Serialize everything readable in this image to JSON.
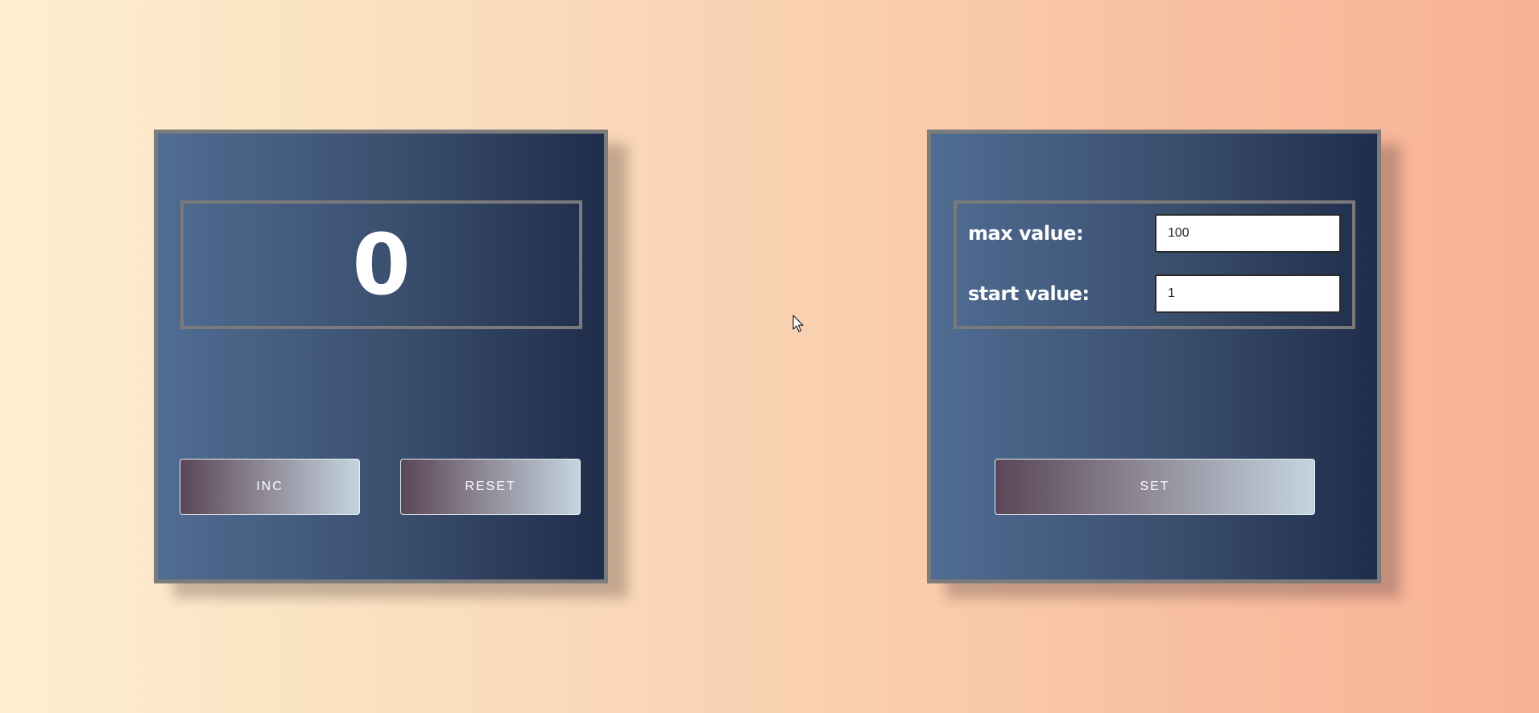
{
  "counter": {
    "value": "0",
    "inc_label": "INC",
    "reset_label": "RESET"
  },
  "settings": {
    "max_label": "max value:",
    "max_value": "100",
    "start_label": "start value:",
    "start_value": "1",
    "set_label": "SET"
  },
  "icons": {
    "cursor": "mouse-pointer-icon"
  },
  "colors": {
    "panel_gradient_start": "#506d93",
    "panel_gradient_end": "#1f2d4b",
    "button_gradient_start": "#5a4658",
    "button_gradient_end": "#c4d5df",
    "background_start": "#fcefcf",
    "background_end": "#f8b095"
  }
}
